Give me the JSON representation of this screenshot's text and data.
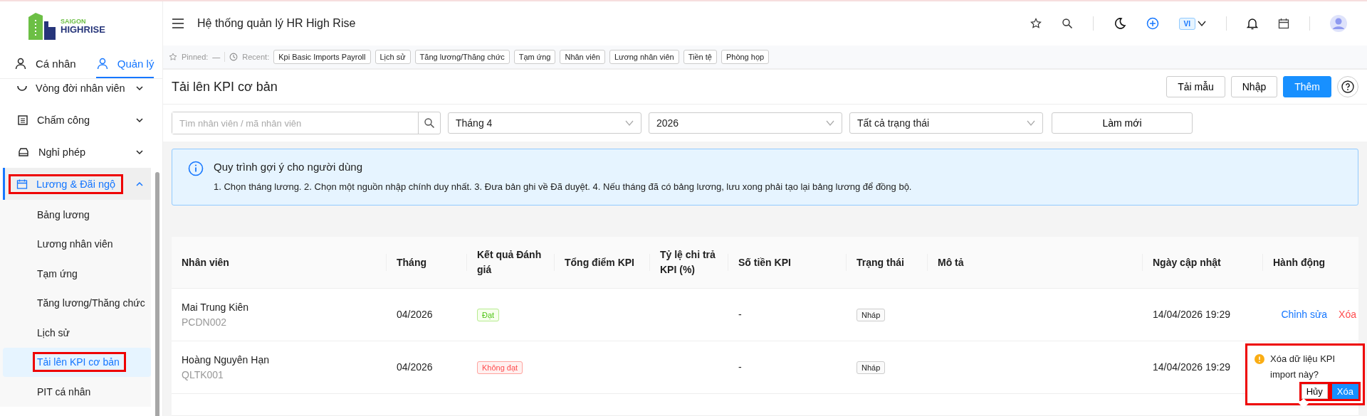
{
  "logo": {
    "line1": "SAIGON",
    "line2": "HIGHRISE"
  },
  "sidebar": {
    "tabs": [
      {
        "label": "Cá nhân",
        "selected": false
      },
      {
        "label": "Quản lý",
        "selected": true
      }
    ],
    "items": [
      {
        "label": "Vòng đời nhân viên",
        "expanded": false,
        "selected": false,
        "highlighted": false
      },
      {
        "label": "Chấm công",
        "expanded": false,
        "selected": false,
        "highlighted": false
      },
      {
        "label": "Nghỉ phép",
        "expanded": false,
        "selected": false,
        "highlighted": false
      },
      {
        "label": "Lương & Đãi ngộ",
        "expanded": true,
        "selected": true,
        "highlighted": true,
        "children": [
          {
            "label": "Bảng lương",
            "selected": false,
            "highlighted": false
          },
          {
            "label": "Lương nhân viên",
            "selected": false,
            "highlighted": false
          },
          {
            "label": "Tạm ứng",
            "selected": false,
            "highlighted": false
          },
          {
            "label": "Tăng lương/Thăng chức",
            "selected": false,
            "highlighted": false
          },
          {
            "label": "Lịch sử",
            "selected": false,
            "highlighted": false
          },
          {
            "label": "Tải lên KPI cơ bản",
            "selected": true,
            "highlighted": true
          },
          {
            "label": "PIT cá nhân",
            "selected": false,
            "highlighted": false
          }
        ]
      }
    ]
  },
  "header": {
    "title": "Hệ thống quản lý HR High Rise",
    "language": "VI"
  },
  "recent_bar": {
    "pinned_label": "Pinned:",
    "pinned_value": "—",
    "recent_label": "Recent:",
    "chips": [
      "Kpi Basic Imports Payroll",
      "Lịch sử",
      "Tăng lương/Thăng chức",
      "Tạm ứng",
      "Nhân viên",
      "Lương nhân viên",
      "Tiền tệ",
      "Phòng họp"
    ]
  },
  "page": {
    "title": "Tải lên KPI cơ bản",
    "buttons": [
      {
        "label": "Tải mẫu",
        "kind": "default"
      },
      {
        "label": "Nhập",
        "kind": "default"
      },
      {
        "label": "Thêm",
        "kind": "primary"
      }
    ],
    "filters": {
      "search": {
        "placeholder": "Tìm nhân viên / mã nhân viên"
      },
      "month": "Tháng 4",
      "year": "2026",
      "status": "Tất cả trạng thái",
      "refresh": "Làm mới"
    },
    "info": {
      "title": "Quy trình gợi ý cho người dùng",
      "text": "1. Chọn tháng lương. 2. Chọn một nguồn nhập chính duy nhất. 3. Đưa bản ghi về Đã duyệt. 4. Nếu tháng đã có bảng lương, lưu xong phải tạo lại bảng lương để đồng bộ."
    }
  },
  "table": {
    "columns": [
      "Nhân viên",
      "Tháng",
      "Kết quả Đánh giá",
      "Tổng điểm KPI",
      "Tỷ lệ chi trả KPI (%)",
      "Số tiền KPI",
      "Trạng thái",
      "Mô tả",
      "Ngày cập nhật",
      "Hành động"
    ],
    "rows": [
      {
        "name": "Mai Trung Kiên",
        "code": "PCDN002",
        "month": "04/2026",
        "result": "Đạt",
        "kind": "pass",
        "amount": "-",
        "status": "Nháp",
        "updated": "14/04/2026 19:29",
        "actions": [
          "Chỉnh sửa",
          "Xóa"
        ]
      },
      {
        "name": "Hoàng Nguyên Hạn",
        "code": "QLTK001",
        "month": "04/2026",
        "result": "Không đạt",
        "kind": "fail",
        "amount": "-",
        "status": "Nháp",
        "updated": "14/04/2026 19:29",
        "actions": []
      }
    ]
  },
  "popconfirm": {
    "message": "Xóa dữ liệu KPI import này?",
    "cancel": "Hủy",
    "ok": "Xóa",
    "highlighted": true
  }
}
